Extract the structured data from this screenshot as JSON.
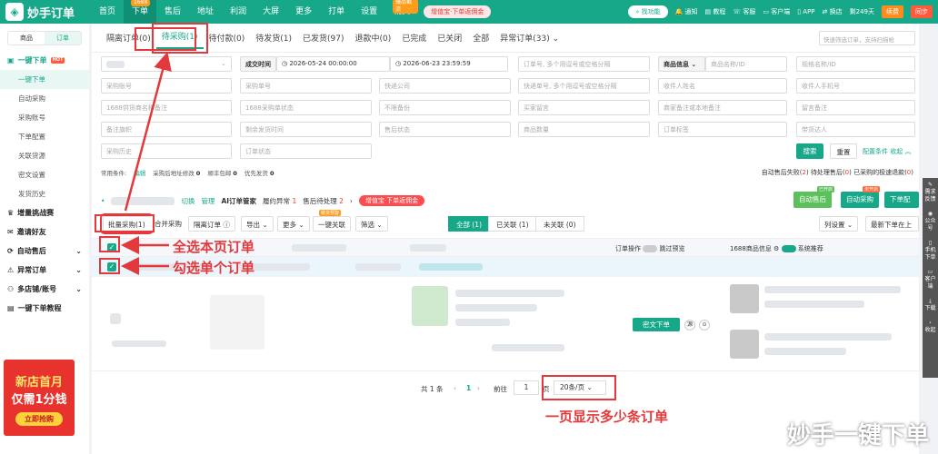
{
  "topbar": {
    "logo_text": "妙手订单",
    "nav": [
      {
        "label": "首页",
        "badge": ""
      },
      {
        "label": "下单",
        "badge": "1688",
        "active": true
      },
      {
        "label": "售后",
        "badge": ""
      },
      {
        "label": "地址",
        "badge": ""
      },
      {
        "label": "利润",
        "badge": ""
      },
      {
        "label": "大屏",
        "badge": ""
      },
      {
        "label": "更多",
        "badge": ""
      },
      {
        "label": "打单",
        "badge": ""
      },
      {
        "label": "设置",
        "badge": ""
      },
      {
        "label": "铺货",
        "badge": "爆品截流"
      }
    ],
    "promo": "增值宝·下单返佣金",
    "search": "找功能",
    "right": [
      "通知",
      "教程",
      "客服",
      "客户端",
      "APP",
      "换店"
    ],
    "new_badge": "NEW",
    "days": "剩249天",
    "renew": "续费",
    "help": "同步"
  },
  "sidebar": {
    "seg": [
      "商品",
      "订单"
    ],
    "items": [
      {
        "label": "一键下单",
        "type": "grp",
        "hot": "HOT"
      },
      {
        "label": "一键下单",
        "type": "sub",
        "on": true
      },
      {
        "label": "自动采购",
        "type": "sub"
      },
      {
        "label": "采购账号",
        "type": "sub"
      },
      {
        "label": "下单配置",
        "type": "sub"
      },
      {
        "label": "关联货源",
        "type": "sub"
      },
      {
        "label": "密文设置",
        "type": "sub"
      },
      {
        "label": "发货历史",
        "type": "sub"
      },
      {
        "label": "增量挑战赛",
        "type": "grp"
      },
      {
        "label": "邀请好友",
        "type": "grp"
      },
      {
        "label": "自动售后",
        "type": "grp"
      },
      {
        "label": "异常订单",
        "type": "grp"
      },
      {
        "label": "多店铺/账号",
        "type": "grp"
      },
      {
        "label": "一键下单教程",
        "type": "grp"
      }
    ],
    "ad": {
      "l1": "新店首月",
      "l2": "仅需1分钱",
      "btn": "立即抢购"
    }
  },
  "tabs": [
    {
      "label": "隔离订单(0)"
    },
    {
      "label": "待采购(1)",
      "on": true
    },
    {
      "label": "待付款(0)"
    },
    {
      "label": "待发货(1)"
    },
    {
      "label": "已发货(97)"
    },
    {
      "label": "退款中(0)"
    },
    {
      "label": "已完成"
    },
    {
      "label": "已关闭"
    },
    {
      "label": "全部"
    },
    {
      "label": "异常订单(33)"
    }
  ],
  "quick_search": "快速筛选订单，支持扫描枪",
  "filters": {
    "time_label": "成交时间",
    "start": "2026-05-24 00:00:00",
    "end": "2026-06-23 23:59:59",
    "order_ph": "订单号, 多个用逗号或空格分隔",
    "goods_tag": "商品信息",
    "goods_ph": "商品名称/ID",
    "spec_ph": "规格名称/ID",
    "r2": [
      "采购账号",
      "采购单号",
      "快递公司",
      "快递单号, 多个用逗号或空格分隔",
      "收件人姓名",
      "收件人手机号"
    ],
    "r3": [
      "1688供货商名称备注",
      "1688采购单状态",
      "不限备份",
      "买家留言",
      "商家备注或本地备注",
      "留言备注"
    ],
    "r4": [
      "备注旗帜",
      "剩余发货时间",
      "售后状态",
      "商品数量",
      "订单标签",
      "带货达人"
    ],
    "r5": [
      "采购历史",
      "订单状态"
    ],
    "search_btn": "搜索",
    "reset_btn": "重置",
    "cfg": "配置条件",
    "collapse": "收起"
  },
  "chips": {
    "label": "常用条件:",
    "edit": "编辑",
    "items": [
      {
        "t": "采购后地址修改",
        "n": "0"
      },
      {
        "t": "顺丰包邮",
        "n": "0"
      },
      {
        "t": "优先发货",
        "n": "0"
      }
    ]
  },
  "right_info": {
    "a": "自动售后失败(",
    "an": "2",
    "b": ") 待处理售后(",
    "bn": "0",
    "c": ") 已采购的极速退款(",
    "cn": "0",
    "d": ")"
  },
  "toolbar1": {
    "switch": "切换",
    "manage": "管理",
    "ai": "AI订单管家",
    "t1": "履约异常",
    "n1": "1",
    "t2": "售后待处理",
    "n2": "2",
    "promo": "增值宝·下单返佣金",
    "b1": "自动售后",
    "b2": "自动采购",
    "b3": "下单配置",
    "tag1": "已开启",
    "tag2": "未开启"
  },
  "toolbar2": {
    "batch": "批量采购(1)",
    "merge": "合并采购",
    "isolate": "隔离订单",
    "export": "导出",
    "more": "更多",
    "relate": "一键关联",
    "relate_tag": "缓货预警",
    "filter": "筛选",
    "tabs": [
      "全部 (1)",
      "已关联 (1)",
      "未关联 (0)"
    ],
    "colset": "列设置",
    "sort": "最新下单在上"
  },
  "thead": {
    "op": "订单操作",
    "skip": "跳过预览",
    "info": "1688商品信息",
    "sys": "系统推荐"
  },
  "row": {
    "btn": "密文下单"
  },
  "annotations": {
    "a1": "全选本页订单",
    "a2": "勾选单个订单",
    "a3": "一页显示多少条订单"
  },
  "pager": {
    "total": "共 1 条",
    "page": "1",
    "goto": "前往",
    "goto_val": "1",
    "page_unit": "页",
    "size": "20条/页"
  },
  "rtool": [
    "需求反馈",
    "公众号",
    "手机下单",
    "客户端",
    "下载",
    "收起"
  ],
  "watermark": "妙手一键下单"
}
